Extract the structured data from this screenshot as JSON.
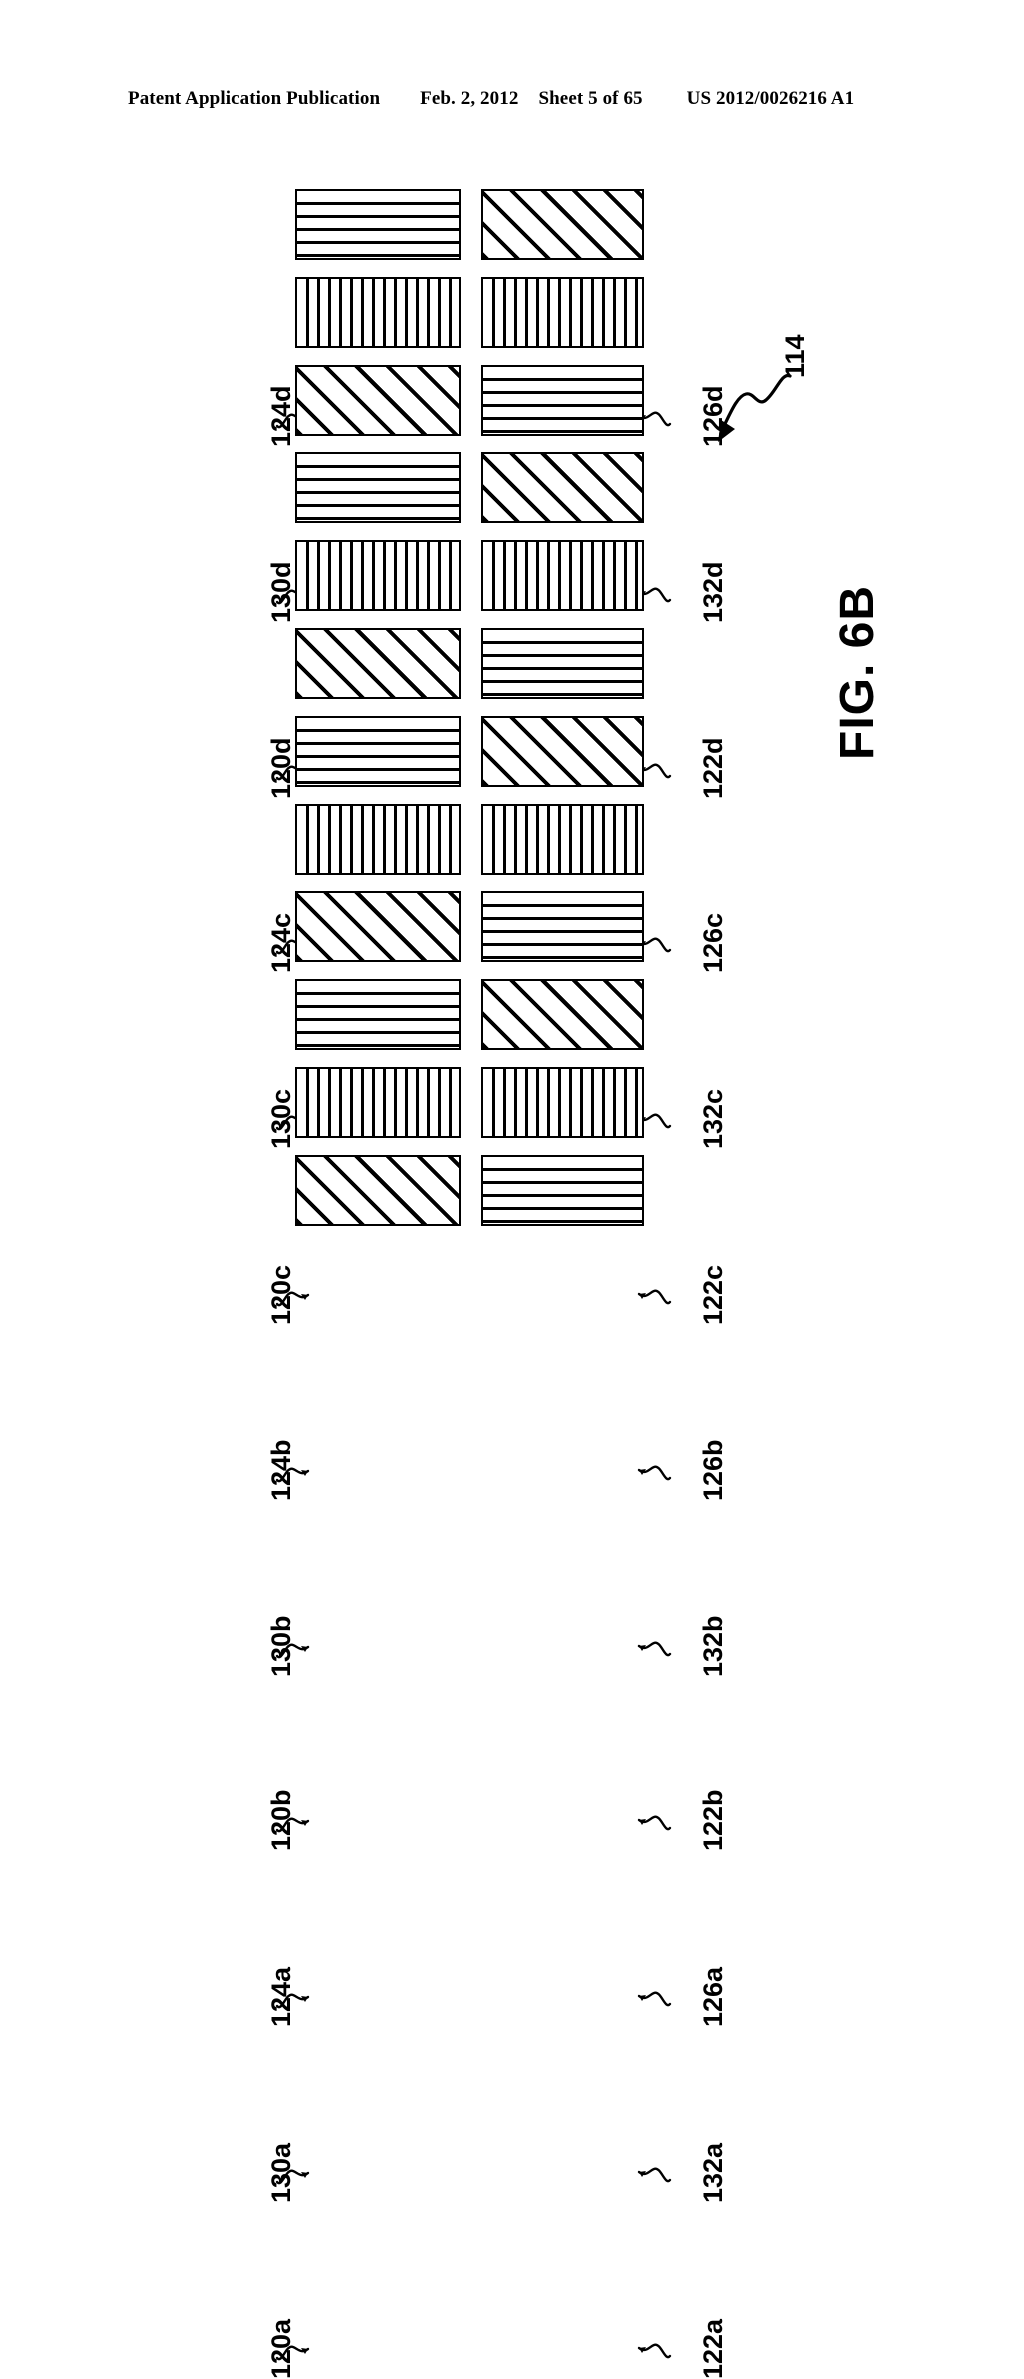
{
  "header": {
    "publication": "Patent Application Publication",
    "date": "Feb. 2, 2012",
    "sheet": "Sheet 5 of 65",
    "doc_number": "US 2012/0026216 A1"
  },
  "figure": {
    "caption": "FIG. 6B",
    "assembly_label": "114",
    "ink_color": "#000000",
    "background_color": "#ffffff",
    "rows": [
      {
        "left_label": "124d",
        "left_pattern": "horizontal-hatch",
        "right_label": "126d",
        "right_pattern": "diagonal-hatch"
      },
      {
        "left_label": "130d",
        "left_pattern": "vertical-hatch",
        "right_label": "132d",
        "right_pattern": "vertical-hatch"
      },
      {
        "left_label": "120d",
        "left_pattern": "diagonal-hatch",
        "right_label": "122d",
        "right_pattern": "horizontal-hatch"
      },
      {
        "left_label": "124c",
        "left_pattern": "horizontal-hatch",
        "right_label": "126c",
        "right_pattern": "diagonal-hatch"
      },
      {
        "left_label": "130c",
        "left_pattern": "vertical-hatch",
        "right_label": "132c",
        "right_pattern": "vertical-hatch"
      },
      {
        "left_label": "120c",
        "left_pattern": "diagonal-hatch",
        "right_label": "122c",
        "right_pattern": "horizontal-hatch"
      },
      {
        "left_label": "124b",
        "left_pattern": "horizontal-hatch",
        "right_label": "126b",
        "right_pattern": "diagonal-hatch"
      },
      {
        "left_label": "130b",
        "left_pattern": "vertical-hatch",
        "right_label": "132b",
        "right_pattern": "vertical-hatch"
      },
      {
        "left_label": "120b",
        "left_pattern": "diagonal-hatch",
        "right_label": "122b",
        "right_pattern": "horizontal-hatch"
      },
      {
        "left_label": "124a",
        "left_pattern": "horizontal-hatch",
        "right_label": "126a",
        "right_pattern": "diagonal-hatch"
      },
      {
        "left_label": "130a",
        "left_pattern": "vertical-hatch",
        "right_label": "132a",
        "right_pattern": "vertical-hatch"
      },
      {
        "left_label": "120a",
        "left_pattern": "diagonal-hatch",
        "right_label": "122a",
        "right_pattern": "horizontal-hatch"
      }
    ]
  }
}
